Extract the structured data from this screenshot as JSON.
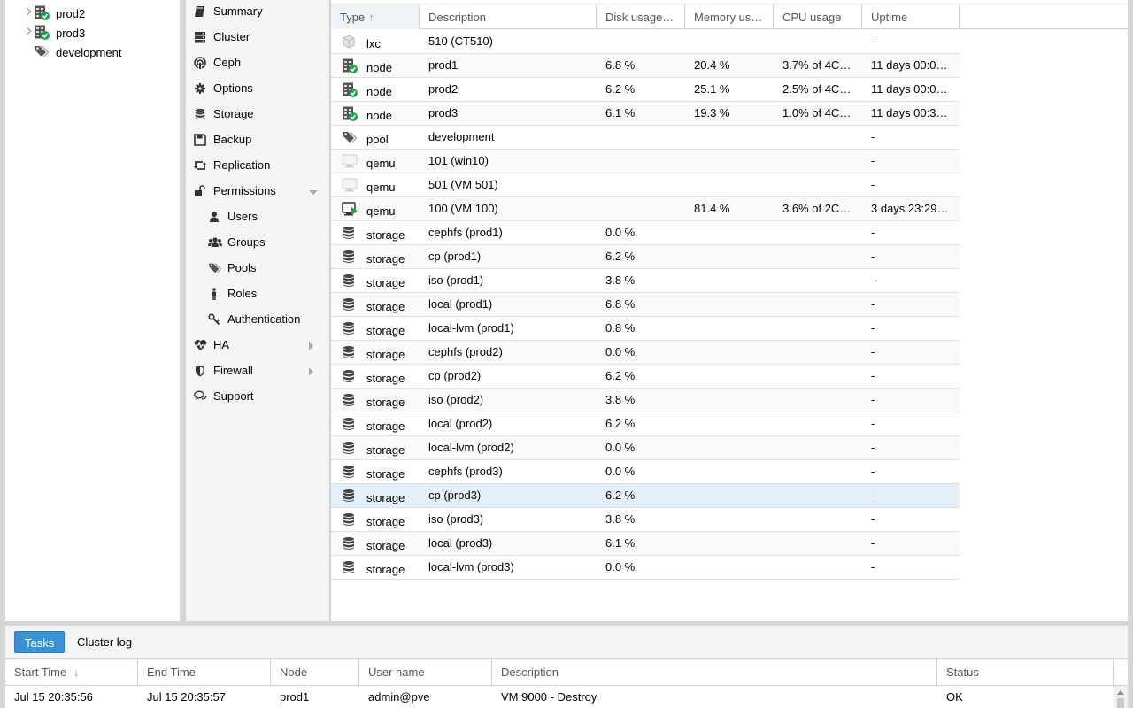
{
  "tree": {
    "items": [
      {
        "label": "prod2",
        "icon": "node-online-icon",
        "expandable": true
      },
      {
        "label": "prod3",
        "icon": "node-online-icon",
        "expandable": true
      },
      {
        "label": "development",
        "icon": "tags-icon",
        "expandable": false
      }
    ]
  },
  "menu": {
    "items": [
      {
        "label": "Summary",
        "icon": "book-icon",
        "indent": 0
      },
      {
        "label": "Cluster",
        "icon": "server-icon",
        "indent": 0
      },
      {
        "label": "Ceph",
        "icon": "ceph-icon",
        "indent": 0
      },
      {
        "label": "Options",
        "icon": "gear-icon",
        "indent": 0
      },
      {
        "label": "Storage",
        "icon": "database-icon",
        "indent": 0
      },
      {
        "label": "Backup",
        "icon": "floppy-icon",
        "indent": 0
      },
      {
        "label": "Replication",
        "icon": "retweet-icon",
        "indent": 0
      },
      {
        "label": "Permissions",
        "icon": "unlock-icon",
        "indent": 0,
        "caret": "down"
      },
      {
        "label": "Users",
        "icon": "user-icon",
        "indent": 1
      },
      {
        "label": "Groups",
        "icon": "users-icon",
        "indent": 1
      },
      {
        "label": "Pools",
        "icon": "tags-icon",
        "indent": 1
      },
      {
        "label": "Roles",
        "icon": "male-icon",
        "indent": 1
      },
      {
        "label": "Authentication",
        "icon": "key-icon",
        "indent": 1
      },
      {
        "label": "HA",
        "icon": "heartbeat-icon",
        "indent": 0,
        "caret": "right"
      },
      {
        "label": "Firewall",
        "icon": "shield-icon",
        "indent": 0,
        "caret": "right"
      },
      {
        "label": "Support",
        "icon": "comments-icon",
        "indent": 0
      }
    ]
  },
  "grid": {
    "columns": [
      "Type",
      "Description",
      "Disk usage…",
      "Memory us…",
      "CPU usage",
      "Uptime"
    ],
    "rows": [
      {
        "type": "lxc",
        "icon": "container-icon",
        "desc": "510 (CT510)",
        "disk": "",
        "mem": "",
        "cpu": "",
        "uptime": "-"
      },
      {
        "type": "node",
        "icon": "node-online-icon",
        "desc": "prod1",
        "disk": "6.8 %",
        "mem": "20.4 %",
        "cpu": "3.7% of 4C…",
        "uptime": "11 days 00:0…"
      },
      {
        "type": "node",
        "icon": "node-online-icon",
        "desc": "prod2",
        "disk": "6.2 %",
        "mem": "25.1 %",
        "cpu": "2.5% of 4C…",
        "uptime": "11 days 00:0…"
      },
      {
        "type": "node",
        "icon": "node-online-icon",
        "desc": "prod3",
        "disk": "6.1 %",
        "mem": "19.3 %",
        "cpu": "1.0% of 4C…",
        "uptime": "11 days 00:3…"
      },
      {
        "type": "pool",
        "icon": "tags-icon",
        "desc": "development",
        "disk": "",
        "mem": "",
        "cpu": "",
        "uptime": "-"
      },
      {
        "type": "qemu",
        "icon": "vm-stopped-icon",
        "desc": "101 (win10)",
        "disk": "",
        "mem": "",
        "cpu": "",
        "uptime": "-"
      },
      {
        "type": "qemu",
        "icon": "vm-stopped-icon",
        "desc": "501 (VM 501)",
        "disk": "",
        "mem": "",
        "cpu": "",
        "uptime": "-"
      },
      {
        "type": "qemu",
        "icon": "vm-running-icon",
        "desc": "100 (VM 100)",
        "disk": "",
        "mem": "81.4 %",
        "cpu": "3.6% of 2C…",
        "uptime": "3 days 23:29…"
      },
      {
        "type": "storage",
        "icon": "database-icon",
        "desc": "cephfs (prod1)",
        "disk": "0.0 %",
        "mem": "",
        "cpu": "",
        "uptime": "-"
      },
      {
        "type": "storage",
        "icon": "database-icon",
        "desc": "cp (prod1)",
        "disk": "6.2 %",
        "mem": "",
        "cpu": "",
        "uptime": "-"
      },
      {
        "type": "storage",
        "icon": "database-icon",
        "desc": "iso (prod1)",
        "disk": "3.8 %",
        "mem": "",
        "cpu": "",
        "uptime": "-"
      },
      {
        "type": "storage",
        "icon": "database-icon",
        "desc": "local (prod1)",
        "disk": "6.8 %",
        "mem": "",
        "cpu": "",
        "uptime": "-"
      },
      {
        "type": "storage",
        "icon": "database-icon",
        "desc": "local-lvm (prod1)",
        "disk": "0.8 %",
        "mem": "",
        "cpu": "",
        "uptime": "-"
      },
      {
        "type": "storage",
        "icon": "database-icon",
        "desc": "cephfs (prod2)",
        "disk": "0.0 %",
        "mem": "",
        "cpu": "",
        "uptime": "-"
      },
      {
        "type": "storage",
        "icon": "database-icon",
        "desc": "cp (prod2)",
        "disk": "6.2 %",
        "mem": "",
        "cpu": "",
        "uptime": "-"
      },
      {
        "type": "storage",
        "icon": "database-icon",
        "desc": "iso (prod2)",
        "disk": "3.8 %",
        "mem": "",
        "cpu": "",
        "uptime": "-"
      },
      {
        "type": "storage",
        "icon": "database-icon",
        "desc": "local (prod2)",
        "disk": "6.2 %",
        "mem": "",
        "cpu": "",
        "uptime": "-"
      },
      {
        "type": "storage",
        "icon": "database-icon",
        "desc": "local-lvm (prod2)",
        "disk": "0.0 %",
        "mem": "",
        "cpu": "",
        "uptime": "-"
      },
      {
        "type": "storage",
        "icon": "database-icon",
        "desc": "cephfs (prod3)",
        "disk": "0.0 %",
        "mem": "",
        "cpu": "",
        "uptime": "-"
      },
      {
        "type": "storage",
        "icon": "database-icon",
        "desc": "cp (prod3)",
        "disk": "6.2 %",
        "mem": "",
        "cpu": "",
        "uptime": "-",
        "selected": true
      },
      {
        "type": "storage",
        "icon": "database-icon",
        "desc": "iso (prod3)",
        "disk": "3.8 %",
        "mem": "",
        "cpu": "",
        "uptime": "-"
      },
      {
        "type": "storage",
        "icon": "database-icon",
        "desc": "local (prod3)",
        "disk": "6.1 %",
        "mem": "",
        "cpu": "",
        "uptime": "-"
      },
      {
        "type": "storage",
        "icon": "database-icon",
        "desc": "local-lvm (prod3)",
        "disk": "0.0 %",
        "mem": "",
        "cpu": "",
        "uptime": "-"
      }
    ]
  },
  "bottom": {
    "tabs": [
      "Tasks",
      "Cluster log"
    ],
    "columns": [
      "Start Time",
      "End Time",
      "Node",
      "User name",
      "Description",
      "Status"
    ],
    "row": {
      "start": "Jul 15 20:35:56",
      "end": "Jul 15 20:35:57",
      "node": "prod1",
      "user": "admin@pve",
      "desc": "VM 9000 - Destroy",
      "status": "OK"
    }
  },
  "colors": {
    "accent": "#3892d4",
    "online": "#21a04a",
    "selected_row": "#e4eff9"
  }
}
